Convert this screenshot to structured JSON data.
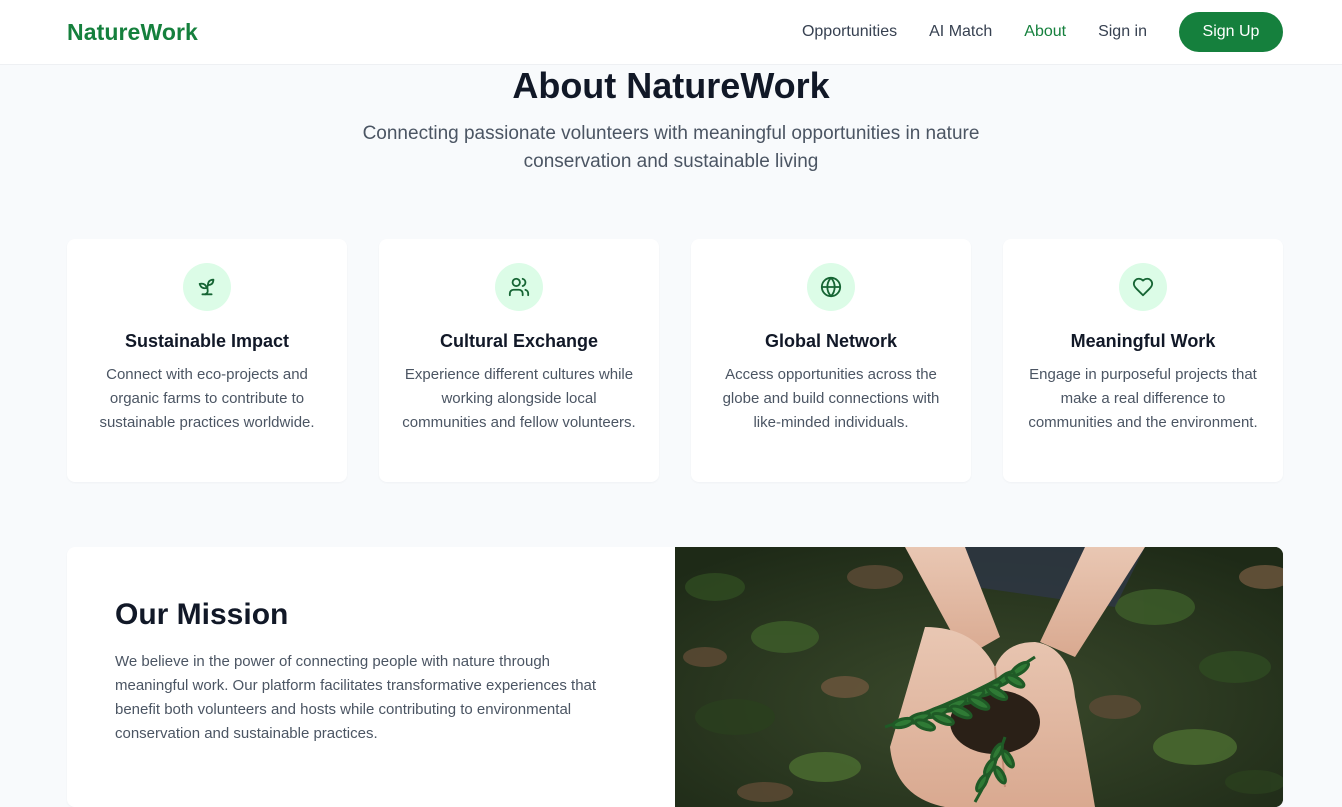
{
  "nav": {
    "brand": "NatureWork",
    "links": [
      {
        "label": "Opportunities",
        "active": false
      },
      {
        "label": "AI Match",
        "active": false
      },
      {
        "label": "About",
        "active": true
      },
      {
        "label": "Sign in",
        "active": false
      }
    ],
    "signup_label": "Sign Up"
  },
  "hero": {
    "title": "About NatureWork",
    "subtitle": "Connecting passionate volunteers with meaningful opportunities in nature conservation and sustainable living"
  },
  "features": [
    {
      "icon": "sprout-icon",
      "title": "Sustainable Impact",
      "description": "Connect with eco-projects and organic farms to contribute to sustainable practices worldwide."
    },
    {
      "icon": "users-icon",
      "title": "Cultural Exchange",
      "description": "Experience different cultures while working alongside local communities and fellow volunteers."
    },
    {
      "icon": "globe-icon",
      "title": "Global Network",
      "description": "Access opportunities across the globe and build connections with like-minded individuals."
    },
    {
      "icon": "heart-icon",
      "title": "Meaningful Work",
      "description": "Engage in purposeful projects that make a real difference to communities and the environment."
    }
  ],
  "mission": {
    "title": "Our Mission",
    "body": "We believe in the power of connecting people with nature through meaningful work. Our platform facilitates transformative experiences that benefit both volunteers and hosts while contributing to environmental conservation and sustainable practices.",
    "image_icon": "hands-holding-seedling-photo"
  },
  "colors": {
    "brand_green": "#15803d",
    "icon_bg": "#dcfce7",
    "page_bg": "#f8fafc"
  }
}
